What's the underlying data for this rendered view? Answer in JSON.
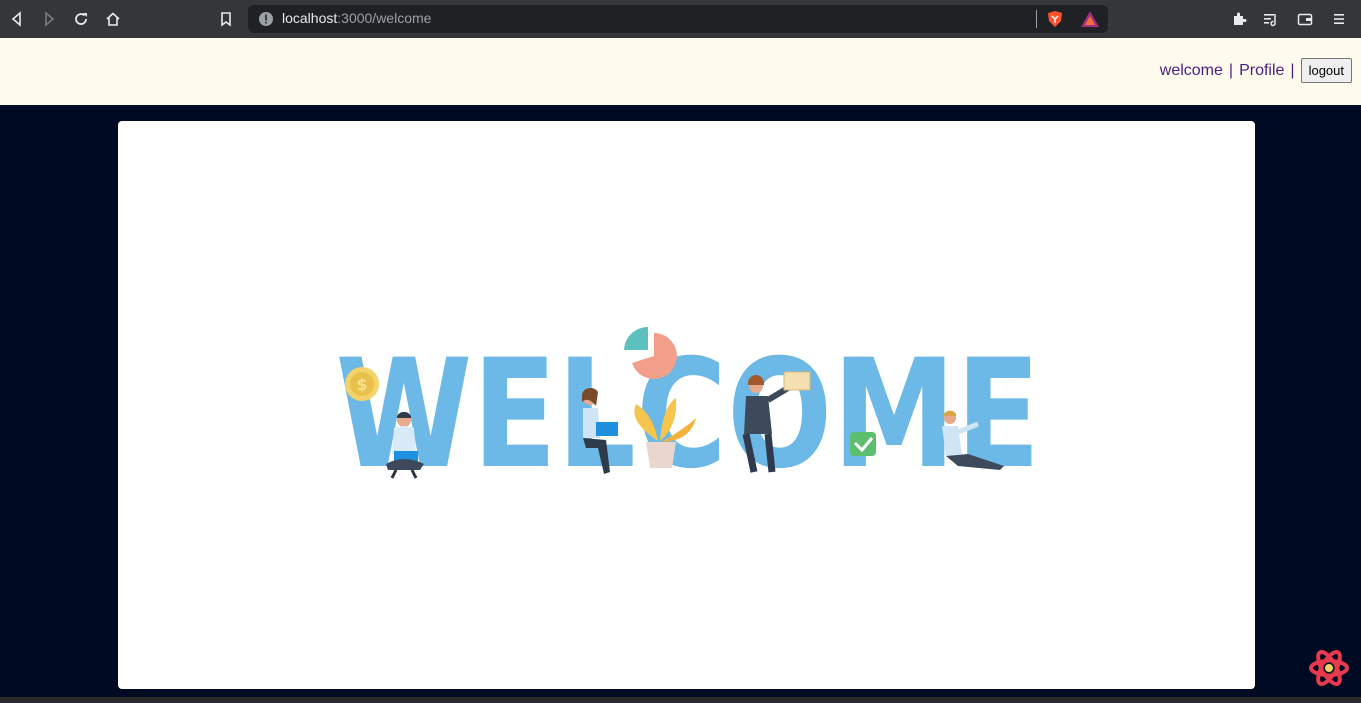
{
  "browser": {
    "url_host": "localhost",
    "url_path": ":3000/welcome"
  },
  "nav": {
    "welcome_link": "welcome",
    "profile_link": "Profile",
    "separator": "|",
    "logout_label": "logout"
  },
  "hero": {
    "word": "WELCOME",
    "word_color": "#6cb8e6"
  },
  "icons": {
    "devtools": "react-devtools-icon"
  }
}
